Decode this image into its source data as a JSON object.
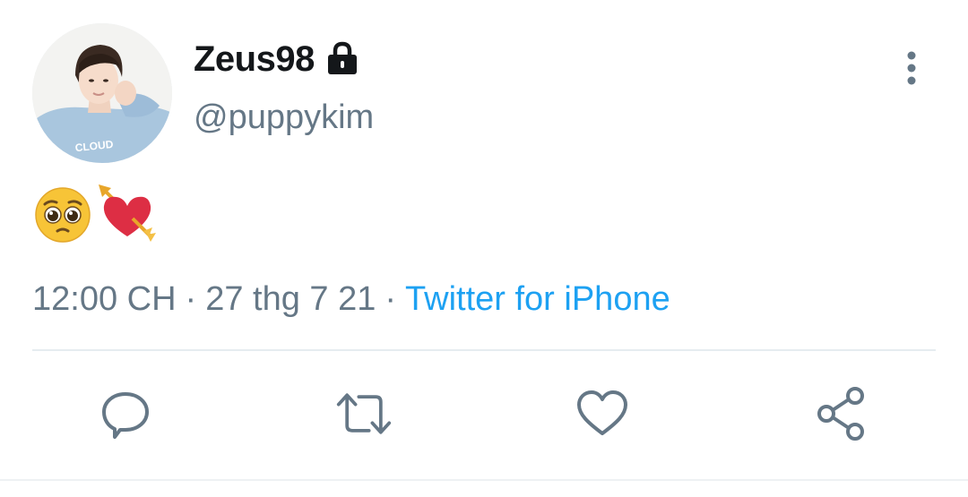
{
  "user": {
    "display_name": "Zeus98",
    "handle": "@puppykim",
    "avatar_text": "CLOUD",
    "protected_icon": "lock-icon"
  },
  "tweet": {
    "emojis": [
      "pleading-face-emoji",
      "heart-with-arrow-emoji"
    ]
  },
  "meta": {
    "time": "12:00 CH",
    "separator": "·",
    "date": "27 thg 7 21",
    "source": "Twitter for iPhone"
  },
  "actions": {
    "reply_icon": "reply-icon",
    "retweet_icon": "retweet-icon",
    "like_icon": "heart-icon",
    "share_icon": "share-icon"
  },
  "colors": {
    "text_primary": "#14171a",
    "text_secondary": "#657786",
    "link": "#1da1f2",
    "divider": "#e6ecf0"
  }
}
